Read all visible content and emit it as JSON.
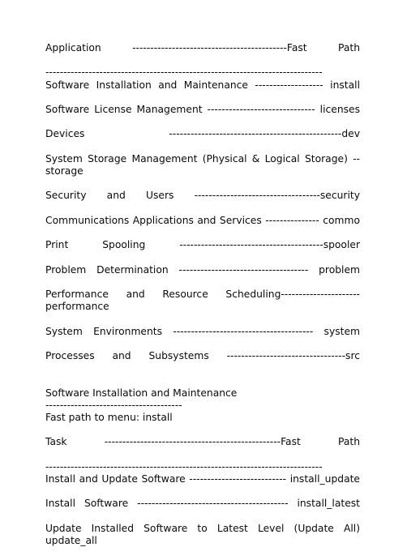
{
  "document": {
    "kind": "smit-fast-path-reference",
    "background_color": "#ffffff",
    "text_color": "#0a0a0a"
  },
  "sections": [
    {
      "id": "application-menu",
      "header_row": {
        "label": "Application",
        "dashes": "-------------------------------------------",
        "fast_path": "Fast Path"
      },
      "rule": "----------------------------------------------------------------------------",
      "rows": [
        {
          "label": "Software Installation and Maintenance",
          "dashes": "-------------------",
          "fast_path": "install"
        },
        {
          "label": "Software License Management",
          "dashes": "------------------------------",
          "fast_path": "licenses"
        },
        {
          "label": "Devices",
          "dashes": "------------------------------------------------------",
          "fast_path": "dev"
        },
        {
          "label": "System Storage Management (Physical & Logical Storage)",
          "dashes": "--",
          "fast_path": "storage"
        },
        {
          "label": "Security and Users",
          "dashes": "------------------------------------------",
          "fast_path": "security"
        },
        {
          "label": "Communications Applications and Services",
          "dashes": "---------------",
          "fast_path": "commo"
        },
        {
          "label": "Print Spooling",
          "dashes": "----------------------------------------------",
          "fast_path": "spooler"
        },
        {
          "label": "Problem Determination",
          "dashes": "-------------------------------------",
          "fast_path": "problem"
        },
        {
          "label": "Performance and Resource Scheduling",
          "dashes": "----------------------",
          "fast_path": "performance"
        },
        {
          "label": "System Environments",
          "dashes": "---------------------------------------",
          "fast_path": "system"
        },
        {
          "label": "Processes and Subsystems",
          "dashes": "---------------------------------",
          "fast_path": "src"
        }
      ]
    },
    {
      "id": "software-installation-and-maintenance",
      "title": "Software Installation and Maintenance",
      "title_underline": "--------------------------------------",
      "fast_path_line": "Fast path to menu: install",
      "header_row": {
        "label": "Task",
        "dashes": "-------------------------------------------------",
        "fast_path": "Fast Path"
      },
      "rule": "----------------------------------------------------------------------------",
      "rows": [
        {
          "label": "Install and Update Software",
          "dashes": "---------------------------",
          "fast_path": "install_update"
        },
        {
          "label": "Install Software",
          "dashes": "---------------------------------------",
          "fast_path": "install_latest"
        },
        {
          "label": "Update Installed Software to Latest Level (Update All)",
          "dashes": "",
          "fast_path": "update_all"
        }
      ]
    }
  ],
  "lines": [
    {
      "type": "entry",
      "name": "app-header-row",
      "text": "Application -------------------------------------------Fast Path"
    },
    {
      "type": "rule",
      "name": "app-header-rule",
      "text": "-----------------------------------------------------------------------------"
    },
    {
      "type": "entry",
      "name": "row-install",
      "text": "Software Installation and Maintenance ------------------- install"
    },
    {
      "type": "entry",
      "name": "row-licenses",
      "text": "Software License Management ------------------------------ licenses"
    },
    {
      "type": "entry",
      "name": "row-dev",
      "text": "Devices ------------------------------------------------dev"
    },
    {
      "type": "entry",
      "name": "row-storage",
      "text": "System Storage Management (Physical & Logical Storage) -- storage"
    },
    {
      "type": "entry",
      "name": "row-security",
      "text": "Security and Users -----------------------------------security"
    },
    {
      "type": "entry",
      "name": "row-commo",
      "text": "Communications Applications and Services --------------- commo"
    },
    {
      "type": "entry",
      "name": "row-spooler",
      "text": "Print Spooling ----------------------------------------spooler"
    },
    {
      "type": "entry",
      "name": "row-problem",
      "text": "Problem Determination ------------------------------------ problem"
    },
    {
      "type": "entry",
      "name": "row-performance",
      "text": "Performance and Resource Scheduling---------------------- performance"
    },
    {
      "type": "entry",
      "name": "row-system",
      "text": "System Environments --------------------------------------- system"
    },
    {
      "type": "entry",
      "name": "row-src",
      "text": "Processes and Subsystems ---------------------------------src"
    },
    {
      "type": "blank",
      "name": "spacer-1",
      "text": ""
    },
    {
      "type": "plain",
      "name": "section-title",
      "text": "Software Installation and Maintenance"
    },
    {
      "type": "plain",
      "name": "section-underline",
      "text": "--------------------------------------"
    },
    {
      "type": "plain",
      "name": "section-fastpath",
      "text": "Fast path to menu: install"
    },
    {
      "type": "blank",
      "name": "spacer-2",
      "text": ""
    },
    {
      "type": "entry",
      "name": "task-header-row",
      "text": "Task -------------------------------------------------Fast Path"
    },
    {
      "type": "rule",
      "name": "task-header-rule",
      "text": "-----------------------------------------------------------------------------"
    },
    {
      "type": "entry",
      "name": "row-install-update",
      "text": "Install and Update Software --------------------------- install_update"
    },
    {
      "type": "entry",
      "name": "row-install-latest",
      "text": "Install Software ------------------------------------------ install_latest"
    },
    {
      "type": "entry",
      "name": "row-update-all",
      "text": "Update Installed Software to Latest Level (Update All) update_all"
    }
  ]
}
